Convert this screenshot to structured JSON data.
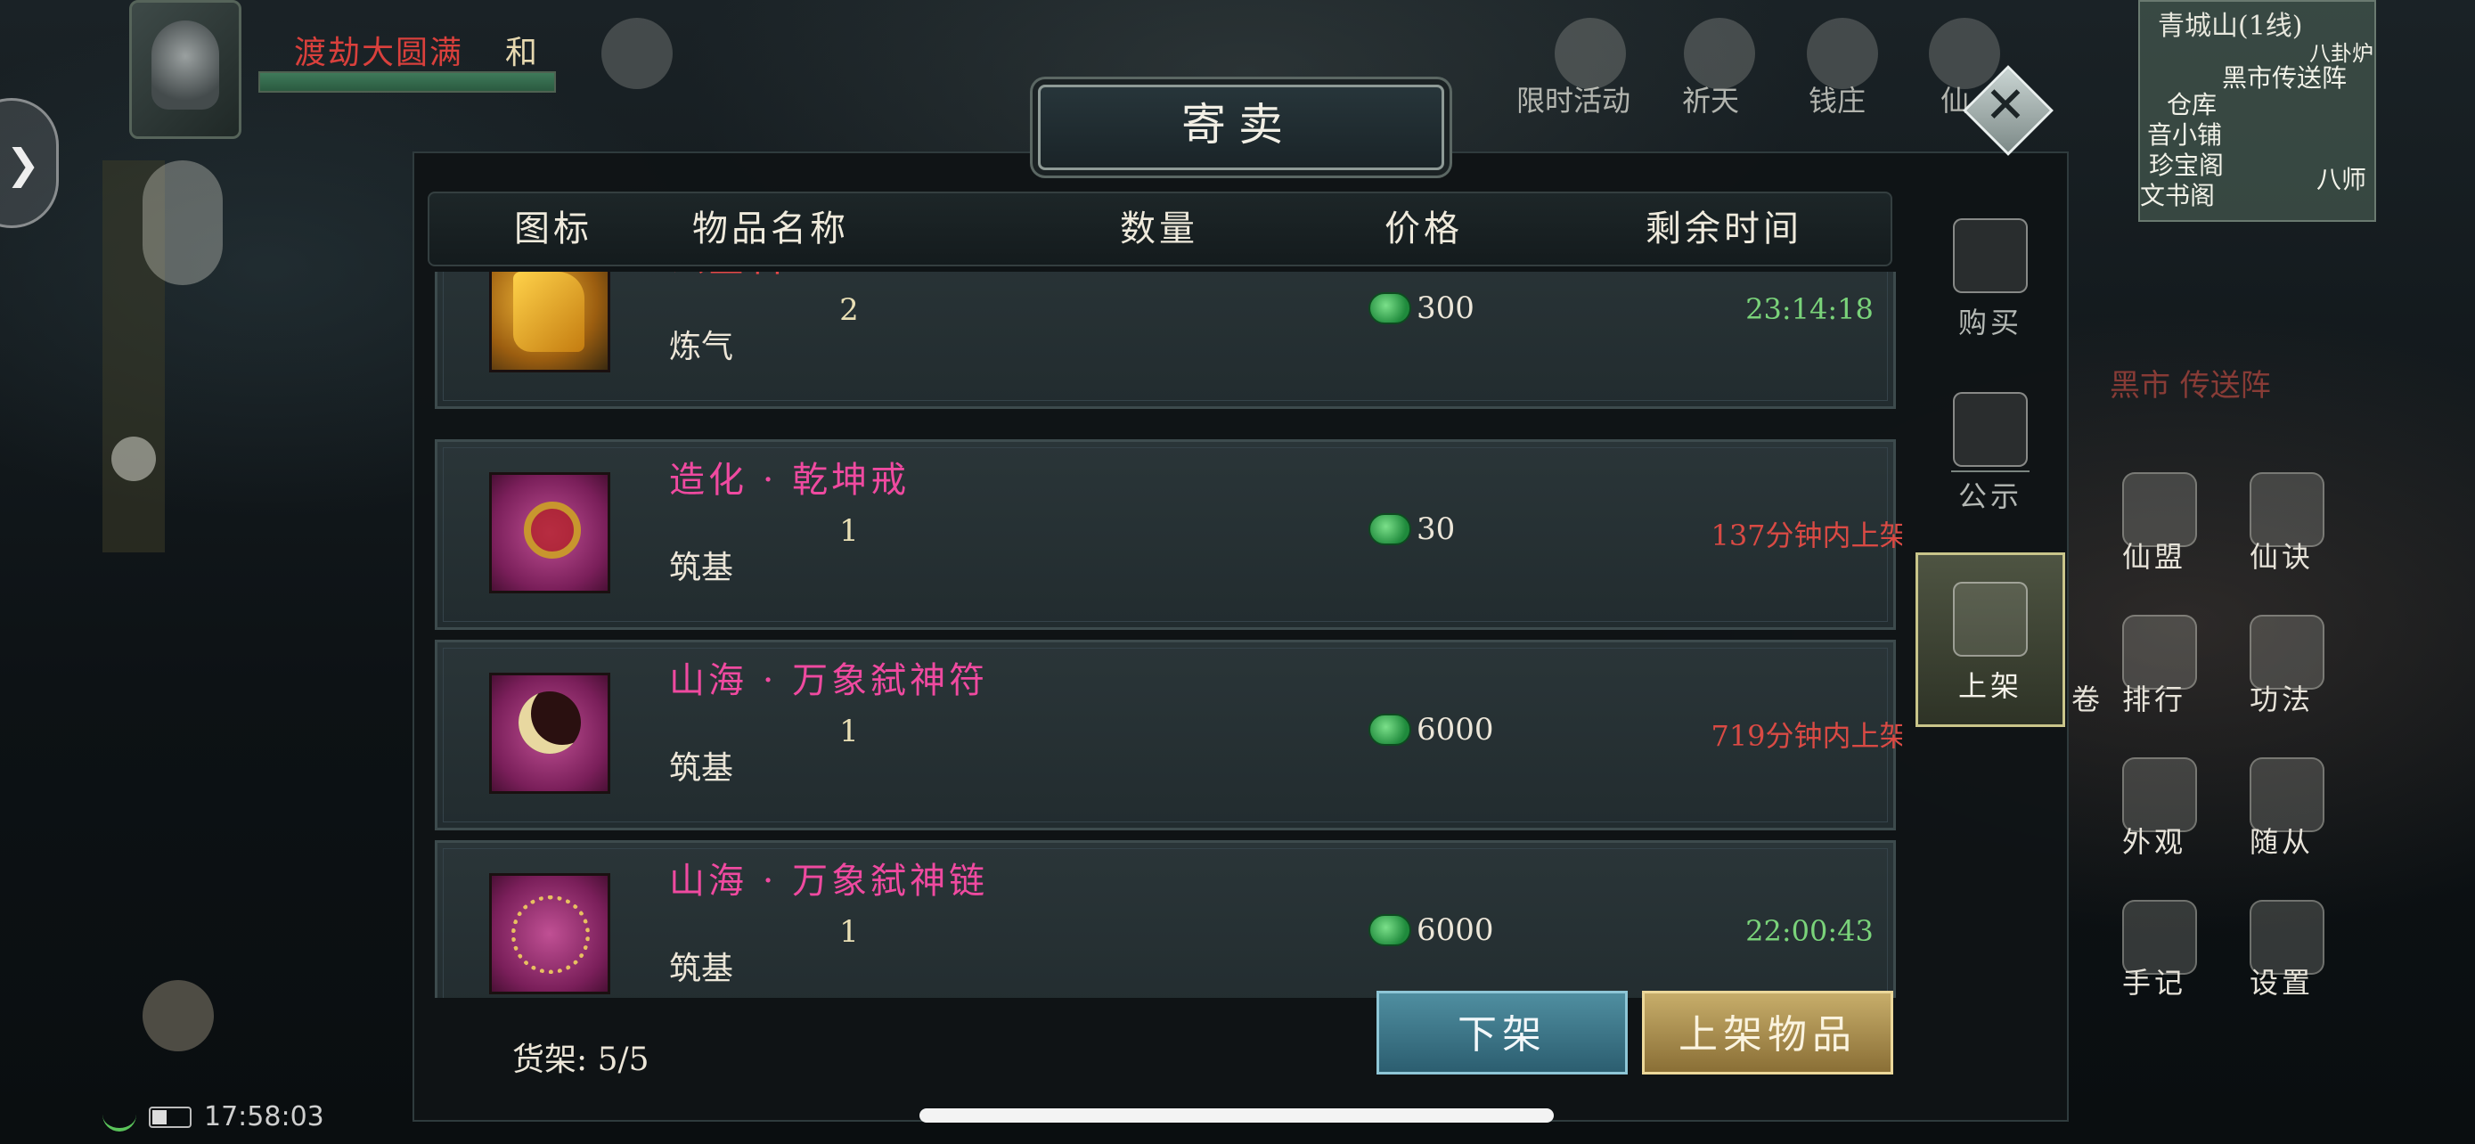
{
  "hud": {
    "realm_name": "渡劫大圆满",
    "realm_tag": "和",
    "clock": "17:58:03"
  },
  "top_icons": [
    {
      "name": "limited-event-icon",
      "label": "限时活动"
    },
    {
      "name": "pray-icon",
      "label": "祈天"
    },
    {
      "name": "money-icon",
      "label": "钱庄"
    },
    {
      "name": "immortal-icon",
      "label": "仙"
    }
  ],
  "minimap": {
    "title": "青城山(1线)",
    "labels": [
      "八卦炉",
      "黑市传送阵",
      "仓库",
      "音小铺",
      "珍宝阁",
      "文书阁",
      "八师"
    ]
  },
  "right_menu": [
    {
      "label": "仙盟"
    },
    {
      "label": "仙诀"
    },
    {
      "label": "排行"
    },
    {
      "label": "功法"
    },
    {
      "label": "外观"
    },
    {
      "label": "随从"
    },
    {
      "label": "手记"
    },
    {
      "label": "设置"
    }
  ],
  "right_menu_extra": {
    "scroll_label": "卷",
    "bg_text": "黑市 传送阵"
  },
  "dialog": {
    "title": "寄卖",
    "columns": {
      "icon": "图标",
      "name": "物品名称",
      "qty": "数量",
      "price": "价格",
      "time": "剩余时间"
    },
    "items": [
      {
        "name": "玄金石",
        "grade": "炼气",
        "qty": "2",
        "price": "300",
        "time": "23:14:18",
        "name_color": "#e84747",
        "time_color": "#7ad37a",
        "icon": "gold-ore-icon"
      },
      {
        "name": "造化 · 乾坤戒",
        "grade": "筑基",
        "qty": "1",
        "price": "30",
        "time": "137分钟内上架",
        "name_color": "#ef4aa0",
        "time_color": "#d94a44",
        "icon": "ring-icon"
      },
      {
        "name": "山海 · 万象弑神符",
        "grade": "筑基",
        "qty": "1",
        "price": "6000",
        "time": "719分钟内上架",
        "name_color": "#ef4aa0",
        "time_color": "#d94a44",
        "icon": "moon-amulet-icon"
      },
      {
        "name": "山海 · 万象弑神链",
        "grade": "筑基",
        "qty": "1",
        "price": "6000",
        "time": "22:00:43",
        "name_color": "#ef4aa0",
        "time_color": "#7ad37a",
        "icon": "necklace-icon"
      }
    ],
    "shelf": "货架: 5/5",
    "btn_unlist": "下架",
    "btn_list": "上架物品",
    "tabs": [
      {
        "label": "购买",
        "active": false
      },
      {
        "label": "公示",
        "active": false
      },
      {
        "label": "上架",
        "active": true
      }
    ]
  }
}
